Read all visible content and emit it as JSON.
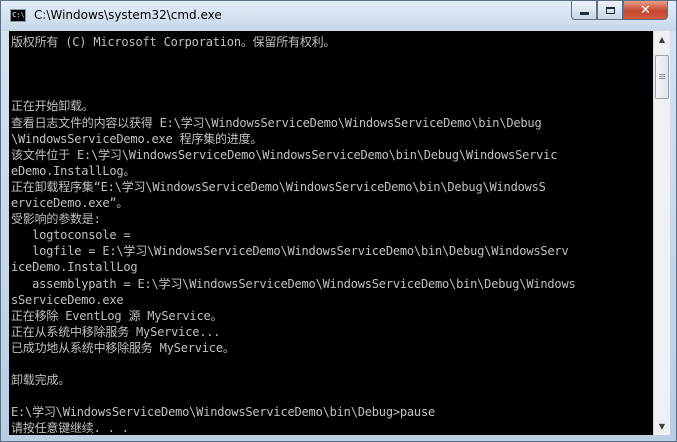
{
  "window": {
    "title": "C:\\Windows\\system32\\cmd.exe",
    "icon_text": "C:\\"
  },
  "controls": {
    "close_glyph": "✕"
  },
  "console": {
    "lines": [
      "版权所有 (C) Microsoft Corporation。保留所有权利。",
      "",
      "",
      "",
      "正在开始卸载。",
      "查看日志文件的内容以获得 E:\\学习\\WindowsServiceDemo\\WindowsServiceDemo\\bin\\Debug",
      "\\WindowsServiceDemo.exe 程序集的进度。",
      "该文件位于 E:\\学习\\WindowsServiceDemo\\WindowsServiceDemo\\bin\\Debug\\WindowsServic",
      "eDemo.InstallLog。",
      "正在卸载程序集“E:\\学习\\WindowsServiceDemo\\WindowsServiceDemo\\bin\\Debug\\WindowsS",
      "erviceDemo.exe”。",
      "受影响的参数是:",
      "   logtoconsole =",
      "   logfile = E:\\学习\\WindowsServiceDemo\\WindowsServiceDemo\\bin\\Debug\\WindowsServ",
      "iceDemo.InstallLog",
      "   assemblypath = E:\\学习\\WindowsServiceDemo\\WindowsServiceDemo\\bin\\Debug\\Windows",
      "sServiceDemo.exe",
      "正在移除 EventLog 源 MyService。",
      "正在从系统中移除服务 MyService...",
      "已成功地从系统中移除服务 MyService。",
      "",
      "卸载完成。",
      "",
      "E:\\学习\\WindowsServiceDemo\\WindowsServiceDemo\\bin\\Debug>pause",
      "请按任意键继续. . ."
    ]
  },
  "scrollbar": {
    "up_arrow": "▲",
    "down_arrow": "▼"
  }
}
